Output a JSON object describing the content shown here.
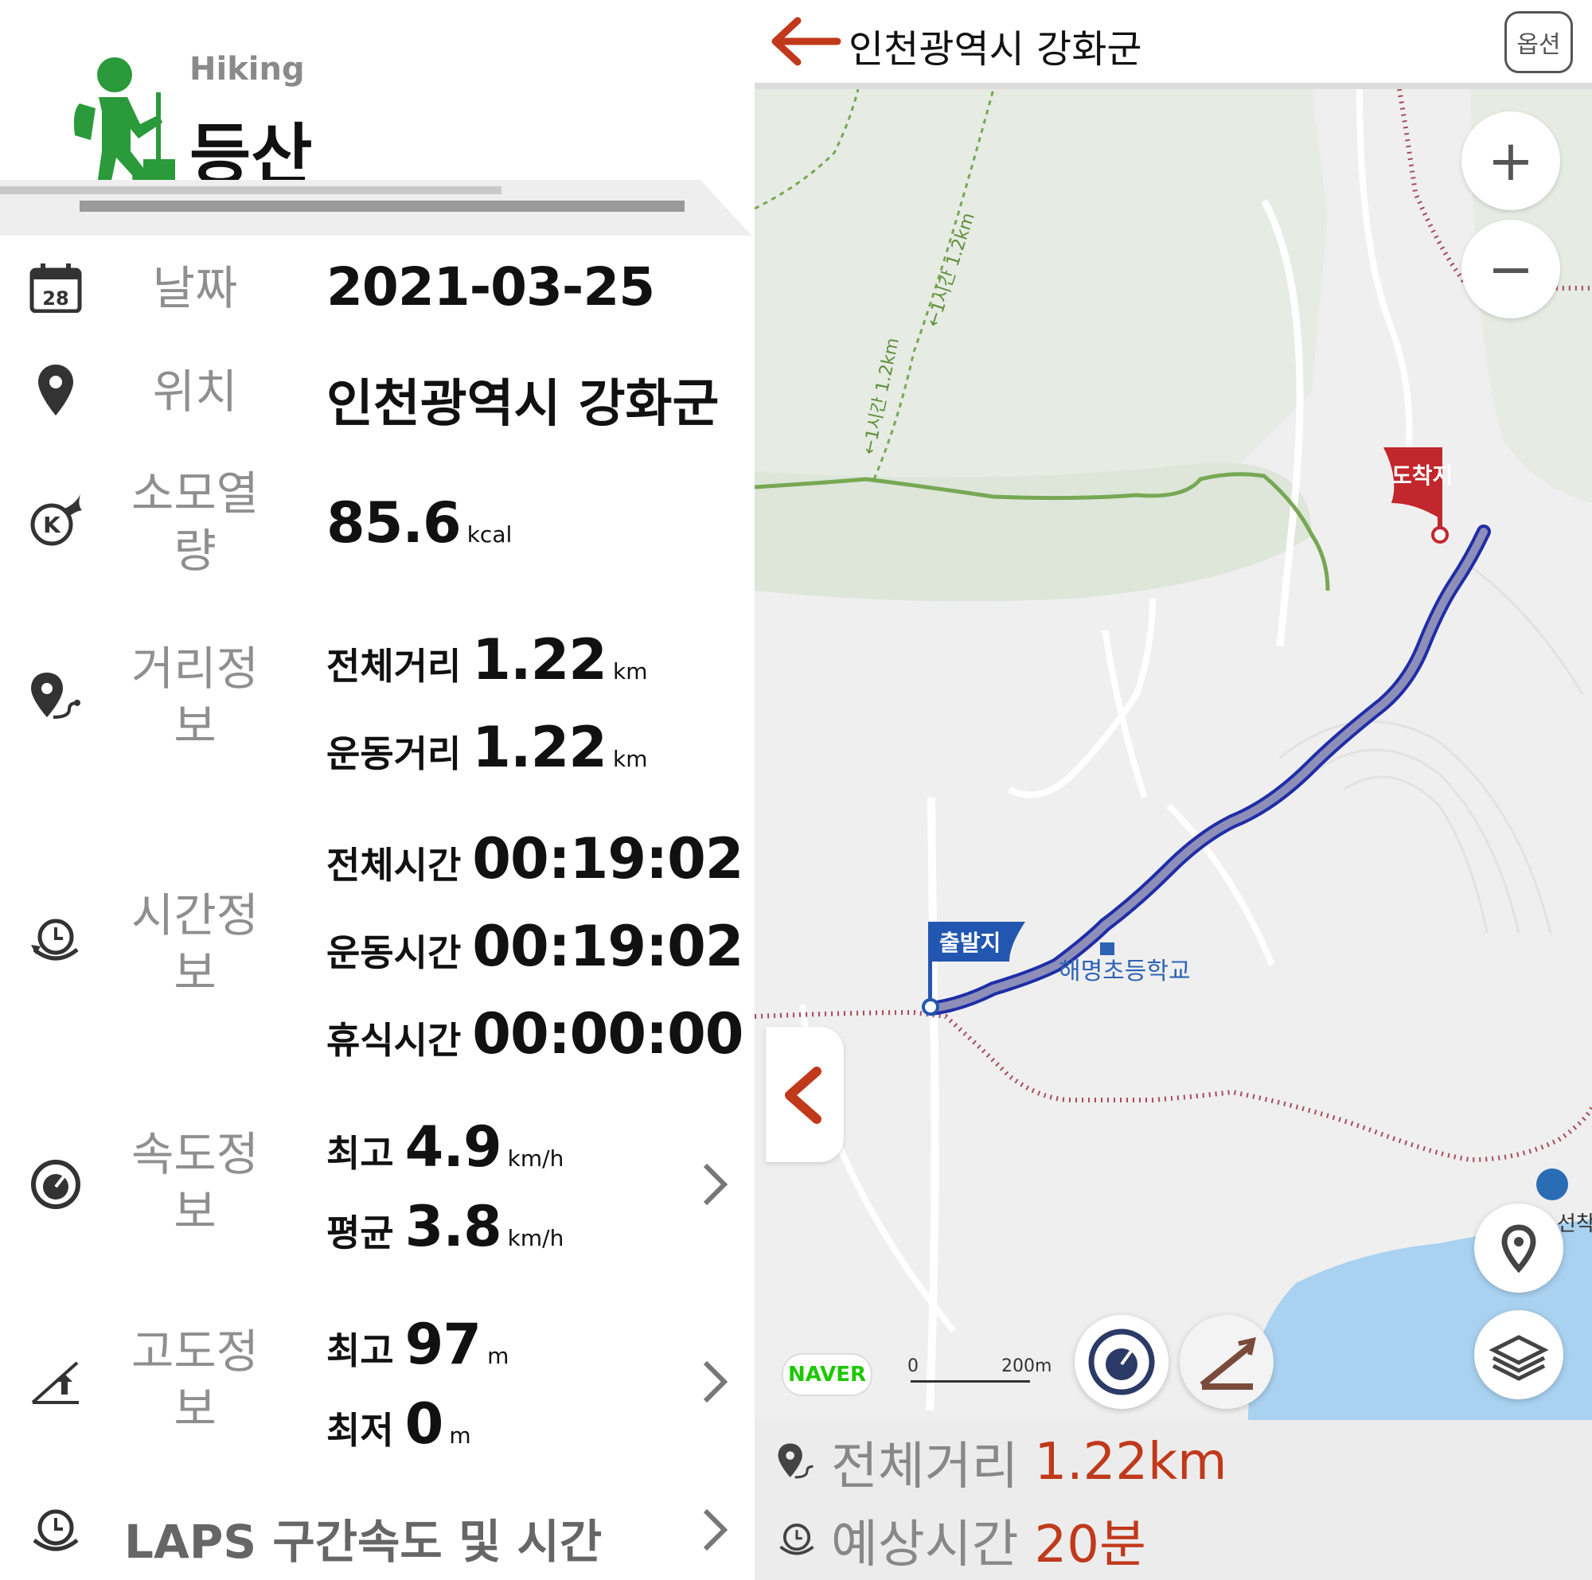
{
  "activity": {
    "english": "Hiking",
    "korean": "등산"
  },
  "rows": {
    "date": {
      "label": "날짜",
      "value": "2021-03-25",
      "icon_day": "28"
    },
    "location": {
      "label": "위치",
      "value": "인천광역시 강화군"
    },
    "calories": {
      "label_line1": "소모열",
      "label_line2": "량",
      "value": "85.6",
      "unit": "kcal",
      "icon_letter": "K"
    },
    "distance": {
      "label_line1": "거리정",
      "label_line2": "보",
      "total_label": "전체거리",
      "total_value": "1.22",
      "total_unit": "km",
      "exercise_label": "운동거리",
      "exercise_value": "1.22",
      "exercise_unit": "km"
    },
    "time": {
      "label_line1": "시간정",
      "label_line2": "보",
      "total_label": "전체시간",
      "total_value": "00:19:02",
      "exercise_label": "운동시간",
      "exercise_value": "00:19:02",
      "rest_label": "휴식시간",
      "rest_value": "00:00:00"
    },
    "speed": {
      "label_line1": "속도정",
      "label_line2": "보",
      "max_label": "최고",
      "max_value": "4.9",
      "max_unit": "km/h",
      "avg_label": "평균",
      "avg_value": "3.8",
      "avg_unit": "km/h"
    },
    "altitude": {
      "label_line1": "고도정",
      "label_line2": "보",
      "max_label": "최고",
      "max_value": "97",
      "max_unit": "m",
      "min_label": "최저",
      "min_value": "0",
      "min_unit": "m"
    },
    "laps": {
      "label": "LAPS 구간속도 및 시간"
    }
  },
  "map_panel": {
    "title": "인천광역시 강화군",
    "options_label": "옵션",
    "zoom_in": "+",
    "zoom_out": "−",
    "start_flag": "출발지",
    "end_flag": "도착지",
    "school": "해명초등학교",
    "trail_label_1": "←1시간 1.2km",
    "trail_label_2": "←1시간 1.2km",
    "edge_label": "선착",
    "naver": "NAVER",
    "scale_zero": "0",
    "scale_max": "200m",
    "summary": {
      "distance_label": "전체거리",
      "distance_value": "1.22km",
      "time_label": "예상시간",
      "time_value": "20분"
    }
  },
  "colors": {
    "accent": "#c0391b",
    "hiker_green": "#2a9a3a",
    "route": "#1f2da8",
    "flag_red": "#c1272d",
    "flag_blue": "#2256b0"
  },
  "icons": [
    "calendar-icon",
    "pin-icon",
    "calorie-fire-icon",
    "distance-icon",
    "clock-icon",
    "speed-gauge-icon",
    "altitude-icon",
    "laps-clock-icon",
    "back-arrow-icon",
    "layers-icon",
    "location-icon"
  ]
}
